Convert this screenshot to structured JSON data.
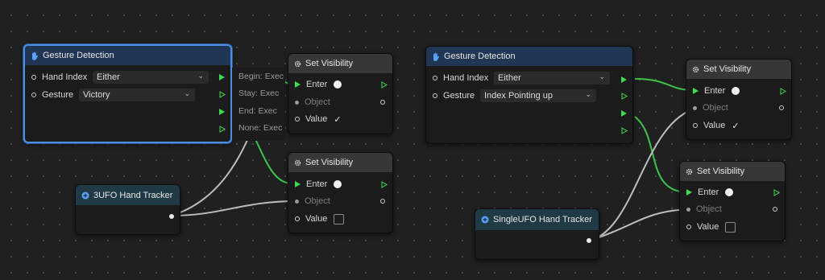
{
  "graph": {
    "nodes": {
      "gesture_detection_1": {
        "title": "Gesture Detection",
        "hand_index_label": "Hand Index",
        "hand_index_value": "Either",
        "gesture_label": "Gesture",
        "gesture_value": "Victory",
        "events": [
          "Begin: Exec",
          "Stay: Exec",
          "End: Exec",
          "None: Exec"
        ]
      },
      "gesture_detection_2": {
        "title": "Gesture Detection",
        "hand_index_label": "Hand Index",
        "hand_index_value": "Either",
        "gesture_label": "Gesture",
        "gesture_value": "Index Pointing up"
      },
      "set_visibility_1": {
        "title": "Set Visibility",
        "enter": "Enter",
        "object": "Object",
        "value": "Value",
        "value_checked": "✓"
      },
      "set_visibility_2": {
        "title": "Set Visibility",
        "enter": "Enter",
        "object": "Object",
        "value": "Value"
      },
      "set_visibility_3": {
        "title": "Set Visibility",
        "enter": "Enter",
        "object": "Object",
        "value": "Value",
        "value_checked": "✓"
      },
      "set_visibility_4": {
        "title": "Set Visibility",
        "enter": "Enter",
        "object": "Object",
        "value": "Value"
      },
      "hand_tracker_1": {
        "title": "3UFO Hand Tracker"
      },
      "hand_tracker_2": {
        "title": "SingleUFO Hand Tracker"
      }
    }
  },
  "colors": {
    "canvas": "#202020",
    "exec_wire": "#3fc24e",
    "object_wire": "#bdbdbd",
    "selected_border": "#4a8fe0",
    "exec_port": "#3ddc4f"
  },
  "icons": {
    "gesture": "hand-icon",
    "set_visibility": "gear-icon",
    "hand_tracker": "plus-circle-icon",
    "dropdown": "chevron-down-icon"
  }
}
